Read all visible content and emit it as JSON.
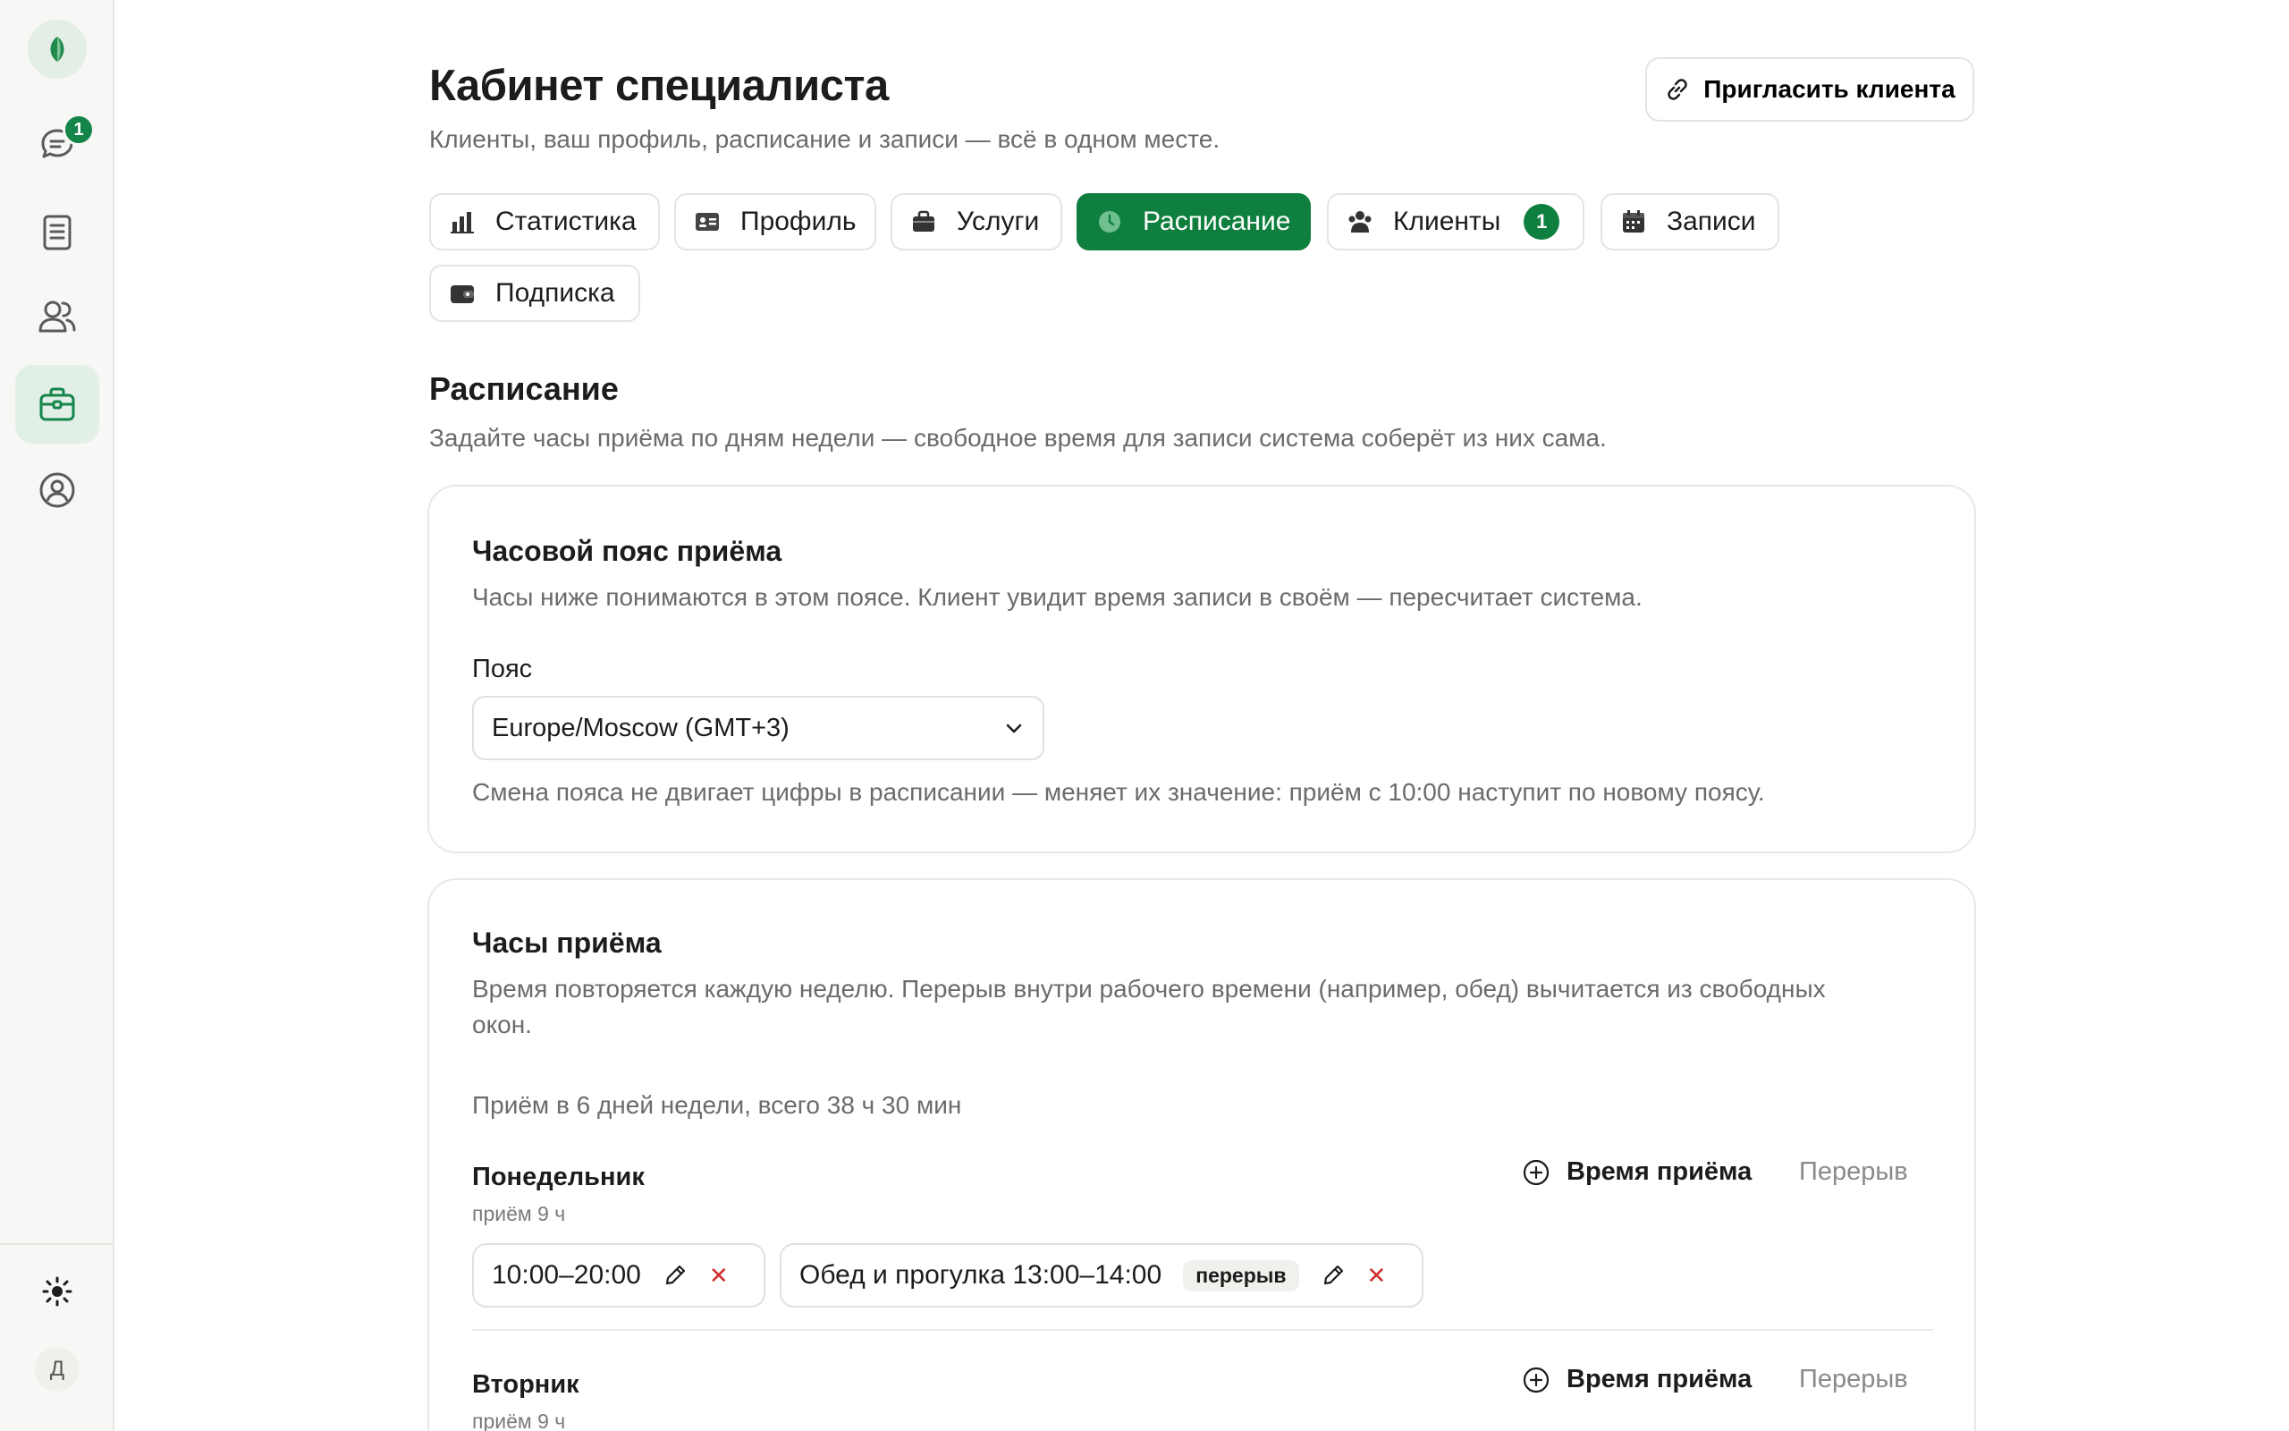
{
  "sidebar": {
    "items": [
      {
        "icon": "chat-icon",
        "badge": "1"
      },
      {
        "icon": "book-icon"
      },
      {
        "icon": "users-icon"
      },
      {
        "icon": "briefcase-icon",
        "active": true
      },
      {
        "icon": "profile-circle-icon"
      }
    ],
    "avatar_letter": "Д",
    "accent": "#14864a"
  },
  "header": {
    "title": "Кабинет специалиста",
    "subtitle": "Клиенты, ваш профиль, расписание и записи — всё в одном месте.",
    "invite_label": "Пригласить клиента"
  },
  "tabs": [
    {
      "label": "Статистика",
      "icon": "bar-chart-icon"
    },
    {
      "label": "Профиль",
      "icon": "id-card-icon"
    },
    {
      "label": "Услуги",
      "icon": "briefcase-icon"
    },
    {
      "label": "Расписание",
      "icon": "clock-icon",
      "active": true
    },
    {
      "label": "Клиенты",
      "icon": "people-icon",
      "badge": "1"
    },
    {
      "label": "Записи",
      "icon": "calendar-icon"
    },
    {
      "label": "Подписка",
      "icon": "wallet-icon"
    }
  ],
  "section": {
    "title": "Расписание",
    "description": "Задайте часы приёма по дням недели — свободное время для записи система соберёт из них сама."
  },
  "timezone_card": {
    "title": "Часовой пояс приёма",
    "description": "Часы ниже понимаются в этом поясе. Клиент увидит время записи в своём — пересчитает система.",
    "field_label": "Пояс",
    "selected": "Europe/Moscow (GMT+3)",
    "note": "Смена пояса не двигает цифры в расписании — меняет их значение: приём с 10:00 наступит по новому поясу."
  },
  "hours_card": {
    "title": "Часы приёма",
    "description_line1": "Время повторяется каждую неделю. Перерыв внутри рабочего времени (например, обед) вычитается из свободных",
    "description_line2": "окон.",
    "summary": "Приём в 6 дней недели, всего 38 ч 30 мин",
    "add_time_label": "Время приёма",
    "add_break_label": "Перерыв",
    "days": [
      {
        "name": "Понедельник",
        "sub": "приём 9 ч",
        "slot": "10:00–20:00",
        "break_label": "Обед и прогулка 13:00–14:00",
        "break_tag": "перерыв"
      },
      {
        "name": "Вторник",
        "sub": "приём 9 ч"
      }
    ]
  }
}
